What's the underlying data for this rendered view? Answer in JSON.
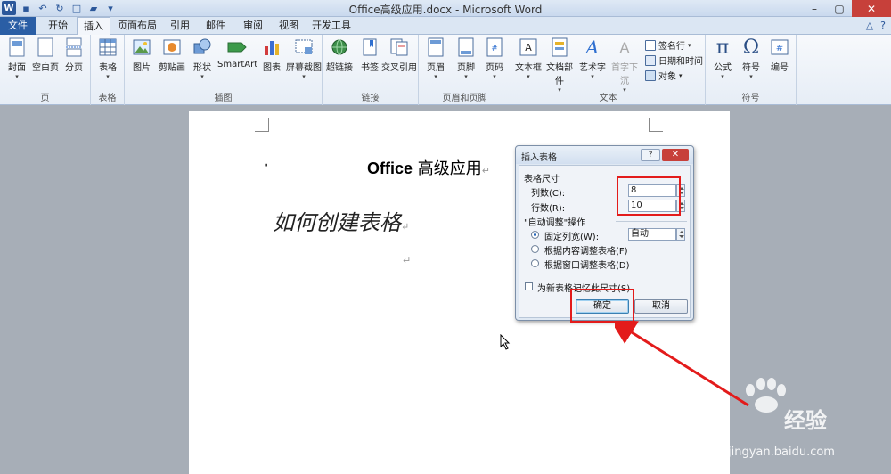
{
  "window": {
    "title": "Office高级应用.docx - Microsoft Word",
    "qat_logo": "W",
    "minimize": "–",
    "maximize": "▢",
    "close": "✕"
  },
  "tabs": [
    "文件",
    "开始",
    "插入",
    "页面布局",
    "引用",
    "邮件",
    "审阅",
    "视图",
    "开发工具"
  ],
  "active_tab": "插入",
  "ribbon": {
    "groups": {
      "pages": "页",
      "tables": "表格",
      "illustrations": "插图",
      "links": "链接",
      "header_footer": "页眉和页脚",
      "text": "文本",
      "symbols": "符号"
    },
    "buttons": {
      "cover": "封面",
      "blank_page": "空白页",
      "page_break": "分页",
      "table": "表格",
      "picture": "图片",
      "clipart": "剪贴画",
      "shapes": "形状",
      "smartart": "SmartArt",
      "chart": "图表",
      "screenshot": "屏幕截图",
      "hyperlink": "超链接",
      "bookmark": "书签",
      "cross_ref": "交叉引用",
      "header": "页眉",
      "footer": "页脚",
      "page_number": "页码",
      "textbox": "文本框",
      "quick_parts": "文档部件",
      "wordart": "艺术字",
      "dropcap": "首字下沉",
      "signature": "签名行",
      "datetime": "日期和时间",
      "object": "对象",
      "equation": "公式",
      "symbol": "符号",
      "number": "编号"
    }
  },
  "document": {
    "title_latin": "Office",
    "title_cn": " 高级应用",
    "subtitle": "如何创建表格",
    "para_mark": "↵",
    "bullet": "·"
  },
  "dialog": {
    "title": "插入表格",
    "help": "?",
    "close": "✕",
    "size_section": "表格尺寸",
    "cols_label": "列数(C):",
    "cols_value": "8",
    "rows_label": "行数(R):",
    "rows_value": "10",
    "autofit_section": "\"自动调整\"操作",
    "fixed_width_label": "固定列宽(W):",
    "fixed_width_value": "自动",
    "fit_content_label": "根据内容调整表格(F)",
    "fit_window_label": "根据窗口调整表格(D)",
    "remember_label": "为新表格记忆此尺寸(S)",
    "ok": "确定",
    "cancel": "取消"
  },
  "watermark": {
    "brand": "Bai",
    "brand_cn": "经验",
    "url": "jingyan.baidu.com"
  },
  "colors": {
    "accent": "#2b579a",
    "annotation": "#e31b1b"
  }
}
